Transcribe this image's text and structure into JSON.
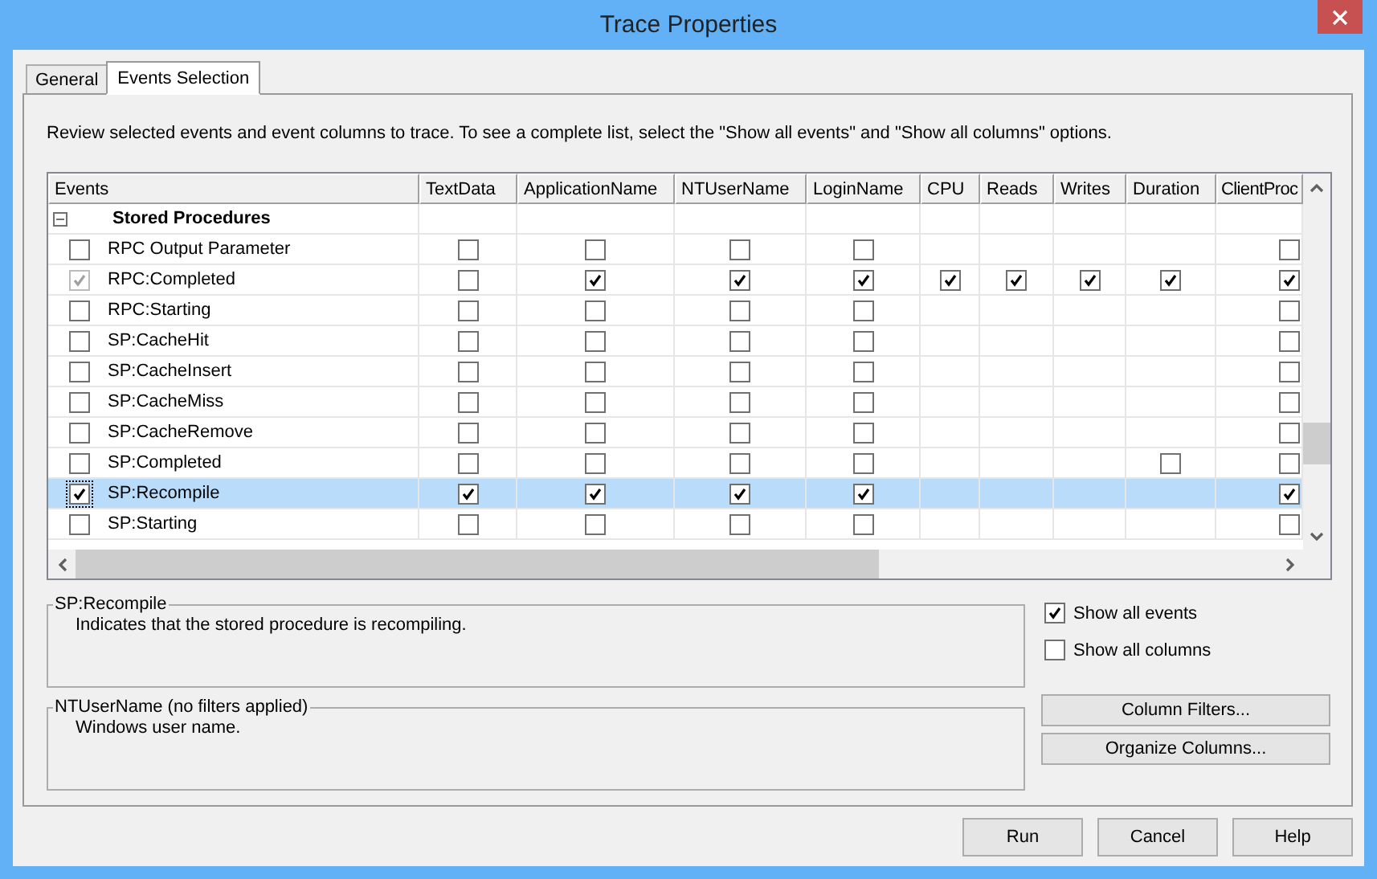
{
  "window": {
    "title": "Trace Properties"
  },
  "tabs": [
    {
      "label": "General",
      "selected": false
    },
    {
      "label": "Events Selection",
      "selected": true
    }
  ],
  "intro": "Review selected events and event columns to trace. To see a complete list, select the \"Show all events\" and \"Show all columns\" options.",
  "grid": {
    "columns": [
      "Events",
      "TextData",
      "ApplicationName",
      "NTUserName",
      "LoginName",
      "CPU",
      "Reads",
      "Writes",
      "Duration",
      "ClientProc"
    ],
    "groups": [
      {
        "name": "Stored Procedures",
        "expanded": true,
        "rows": [
          {
            "event": "RPC Output Parameter",
            "checked": false,
            "disabled": false,
            "selected": false,
            "cells": [
              {
                "kind": "checkbox",
                "checked": false
              },
              {
                "kind": "checkbox",
                "checked": false
              },
              {
                "kind": "checkbox",
                "checked": false
              },
              {
                "kind": "checkbox",
                "checked": false
              },
              {
                "kind": "blank"
              },
              {
                "kind": "blank"
              },
              {
                "kind": "blank"
              },
              {
                "kind": "blank"
              },
              {
                "kind": "checkbox",
                "checked": false
              }
            ]
          },
          {
            "event": "RPC:Completed",
            "checked": true,
            "disabled": true,
            "selected": false,
            "cells": [
              {
                "kind": "checkbox",
                "checked": false
              },
              {
                "kind": "checkbox",
                "checked": true
              },
              {
                "kind": "checkbox",
                "checked": true
              },
              {
                "kind": "checkbox",
                "checked": true
              },
              {
                "kind": "checkbox",
                "checked": true
              },
              {
                "kind": "checkbox",
                "checked": true
              },
              {
                "kind": "checkbox",
                "checked": true
              },
              {
                "kind": "checkbox",
                "checked": true
              },
              {
                "kind": "checkbox",
                "checked": true
              }
            ]
          },
          {
            "event": "RPC:Starting",
            "checked": false,
            "disabled": false,
            "selected": false,
            "cells": [
              {
                "kind": "checkbox",
                "checked": false
              },
              {
                "kind": "checkbox",
                "checked": false
              },
              {
                "kind": "checkbox",
                "checked": false
              },
              {
                "kind": "checkbox",
                "checked": false
              },
              {
                "kind": "blank"
              },
              {
                "kind": "blank"
              },
              {
                "kind": "blank"
              },
              {
                "kind": "blank"
              },
              {
                "kind": "checkbox",
                "checked": false
              }
            ]
          },
          {
            "event": "SP:CacheHit",
            "checked": false,
            "disabled": false,
            "selected": false,
            "cells": [
              {
                "kind": "checkbox",
                "checked": false
              },
              {
                "kind": "checkbox",
                "checked": false
              },
              {
                "kind": "checkbox",
                "checked": false
              },
              {
                "kind": "checkbox",
                "checked": false
              },
              {
                "kind": "blank"
              },
              {
                "kind": "blank"
              },
              {
                "kind": "blank"
              },
              {
                "kind": "blank"
              },
              {
                "kind": "checkbox",
                "checked": false
              }
            ]
          },
          {
            "event": "SP:CacheInsert",
            "checked": false,
            "disabled": false,
            "selected": false,
            "cells": [
              {
                "kind": "checkbox",
                "checked": false
              },
              {
                "kind": "checkbox",
                "checked": false
              },
              {
                "kind": "checkbox",
                "checked": false
              },
              {
                "kind": "checkbox",
                "checked": false
              },
              {
                "kind": "blank"
              },
              {
                "kind": "blank"
              },
              {
                "kind": "blank"
              },
              {
                "kind": "blank"
              },
              {
                "kind": "checkbox",
                "checked": false
              }
            ]
          },
          {
            "event": "SP:CacheMiss",
            "checked": false,
            "disabled": false,
            "selected": false,
            "cells": [
              {
                "kind": "checkbox",
                "checked": false
              },
              {
                "kind": "checkbox",
                "checked": false
              },
              {
                "kind": "checkbox",
                "checked": false
              },
              {
                "kind": "checkbox",
                "checked": false
              },
              {
                "kind": "blank"
              },
              {
                "kind": "blank"
              },
              {
                "kind": "blank"
              },
              {
                "kind": "blank"
              },
              {
                "kind": "checkbox",
                "checked": false
              }
            ]
          },
          {
            "event": "SP:CacheRemove",
            "checked": false,
            "disabled": false,
            "selected": false,
            "cells": [
              {
                "kind": "checkbox",
                "checked": false
              },
              {
                "kind": "checkbox",
                "checked": false
              },
              {
                "kind": "checkbox",
                "checked": false
              },
              {
                "kind": "checkbox",
                "checked": false
              },
              {
                "kind": "blank"
              },
              {
                "kind": "blank"
              },
              {
                "kind": "blank"
              },
              {
                "kind": "blank"
              },
              {
                "kind": "checkbox",
                "checked": false
              }
            ]
          },
          {
            "event": "SP:Completed",
            "checked": false,
            "disabled": false,
            "selected": false,
            "cells": [
              {
                "kind": "checkbox",
                "checked": false
              },
              {
                "kind": "checkbox",
                "checked": false
              },
              {
                "kind": "checkbox",
                "checked": false
              },
              {
                "kind": "checkbox",
                "checked": false
              },
              {
                "kind": "blank"
              },
              {
                "kind": "blank"
              },
              {
                "kind": "blank"
              },
              {
                "kind": "checkbox",
                "checked": false
              },
              {
                "kind": "checkbox",
                "checked": false
              }
            ]
          },
          {
            "event": "SP:Recompile",
            "checked": true,
            "disabled": false,
            "selected": true,
            "cells": [
              {
                "kind": "checkbox",
                "checked": true
              },
              {
                "kind": "checkbox",
                "checked": true
              },
              {
                "kind": "checkbox",
                "checked": true
              },
              {
                "kind": "checkbox",
                "checked": true
              },
              {
                "kind": "blank"
              },
              {
                "kind": "blank"
              },
              {
                "kind": "blank"
              },
              {
                "kind": "blank"
              },
              {
                "kind": "checkbox",
                "checked": true
              }
            ]
          },
          {
            "event": "SP:Starting",
            "checked": false,
            "disabled": false,
            "selected": false,
            "cells": [
              {
                "kind": "checkbox",
                "checked": false
              },
              {
                "kind": "checkbox",
                "checked": false
              },
              {
                "kind": "checkbox",
                "checked": false
              },
              {
                "kind": "checkbox",
                "checked": false
              },
              {
                "kind": "blank"
              },
              {
                "kind": "blank"
              },
              {
                "kind": "blank"
              },
              {
                "kind": "blank"
              },
              {
                "kind": "checkbox",
                "checked": false
              }
            ]
          }
        ]
      }
    ]
  },
  "event_description": {
    "title": "SP:Recompile",
    "text": "Indicates that the stored procedure is recompiling."
  },
  "column_description": {
    "title": "NTUserName (no filters applied)",
    "text": "Windows user name."
  },
  "options": [
    {
      "label": "Show all events",
      "checked": true
    },
    {
      "label": "Show all columns",
      "checked": false
    }
  ],
  "side_buttons": [
    "Column Filters...",
    "Organize Columns..."
  ],
  "dialog_buttons": [
    "Run",
    "Cancel",
    "Help"
  ]
}
